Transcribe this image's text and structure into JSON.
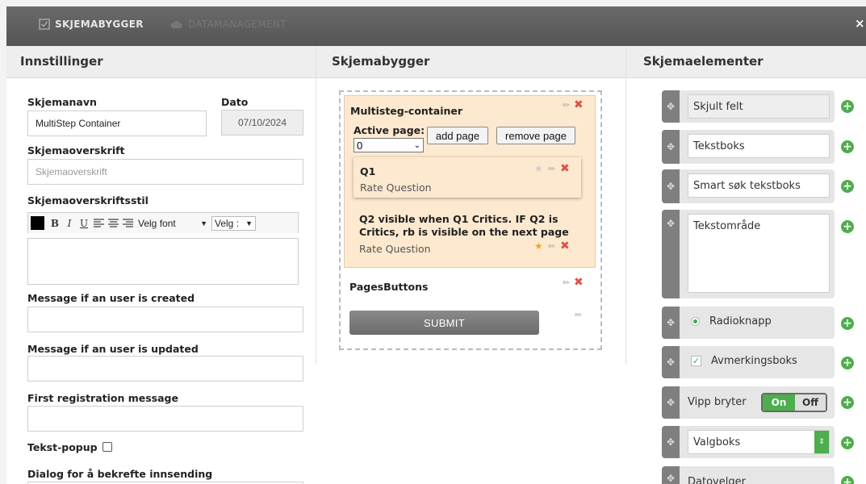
{
  "tabs": [
    {
      "label": "SKJEMABYGGER",
      "icon": "form-icon",
      "active": true
    },
    {
      "label": "DATAMANAGEMENT",
      "icon": "cloud-icon",
      "active": false
    }
  ],
  "close_label": "×",
  "columns": {
    "settings": "Innstillinger",
    "builder": "Skjemabygger",
    "elements": "Skjemaelementer"
  },
  "settings": {
    "form_name_label": "Skjemanavn",
    "form_name_value": "MultiStep Container",
    "date_label": "Dato",
    "date_value": "07/10/2024",
    "heading_label": "Skjemaoverskrift",
    "heading_placeholder": "Skjemaoverskrift",
    "heading_style_label": "Skjemaoverskriftsstil",
    "toolbar": {
      "bold": "B",
      "italic": "I",
      "underline": "U",
      "font_select": "Velg font",
      "size_select": "Velg :"
    },
    "user_created_label": "Message if an user is created",
    "user_updated_label": "Message if an user is updated",
    "first_registration_label": "First registration message",
    "text_popup_label": "Tekst-popup",
    "confirm_dialog_label": "Dialog for å bekrefte innsending"
  },
  "builder": {
    "container_title": "Multisteg-container",
    "active_page_label": "Active page:",
    "active_page_value": "0",
    "add_page_label": "add page",
    "remove_page_label": "remove page",
    "q1_title": "Q1",
    "q1_type": "Rate Question",
    "q2_title": "Q2 visible when Q1 Critics. IF Q2 is Critics, rb is visible on the next page",
    "q2_type": "Rate Question",
    "pages_buttons_label": "PagesButtons",
    "submit_label": "SUBMIT"
  },
  "elements": [
    {
      "label": "Skjult felt"
    },
    {
      "label": "Tekstboks"
    },
    {
      "label": "Smart søk tekstboks"
    },
    {
      "label": "Tekstområde"
    },
    {
      "label": "Radioknapp"
    },
    {
      "label": "Avmerkingsboks"
    },
    {
      "label": "Vipp bryter",
      "on": "On",
      "off": "Off"
    },
    {
      "label": "Valgboks"
    },
    {
      "label": "Datovelger"
    }
  ],
  "colors": {
    "accent_green": "#4cae4c",
    "delete_red": "#d9534f",
    "container_bg": "#fde9cf",
    "titlebar": "#5e5e5e"
  }
}
